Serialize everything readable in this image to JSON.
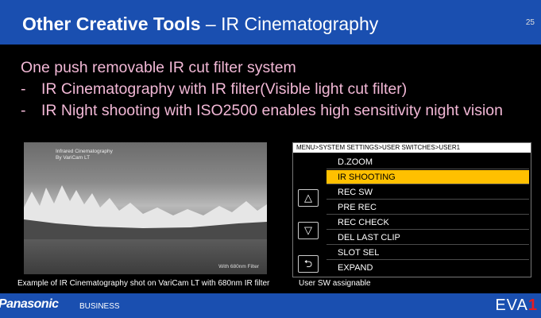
{
  "header": {
    "title_bold": "Other Creative Tools",
    "title_rest": " – IR Cinematography",
    "page_number": "25"
  },
  "bullets": {
    "intro": "One push removable IR cut filter system",
    "items": [
      "IR Cinematography with IR filter(Visible light cut filter)",
      "IR Night shooting with ISO2500 enables high sensitivity night vision"
    ],
    "dash": "-"
  },
  "photo": {
    "overlay_line1": "Infrared Cinematography",
    "overlay_line2": "By VariCam LT",
    "filter_label": "With 680nm Filter",
    "caption": "Example of IR Cinematography shot on VariCam LT with 680nm IR filter"
  },
  "menu": {
    "path": "MENU>SYSTEM SETTINGS>USER SWITCHES>USER1",
    "items": [
      "D.ZOOM",
      "IR SHOOTING",
      "REC SW",
      "PRE REC",
      "REC CHECK",
      "DEL LAST CLIP",
      "SLOT SEL",
      "EXPAND"
    ],
    "selected": "IR SHOOTING",
    "up_glyph": "△",
    "down_glyph": "▽",
    "back_glyph": "⮌",
    "caption": "User SW assignable"
  },
  "footer": {
    "brand": "Panasonic",
    "brand_sub": "BUSINESS",
    "product_prefix": "EVA",
    "product_suffix": "1"
  },
  "colors": {
    "title_bar": "#1a4fb0",
    "bullet_text": "#f2b8d6",
    "selected_item": "#ffc000",
    "brand_red": "#e51c23"
  }
}
